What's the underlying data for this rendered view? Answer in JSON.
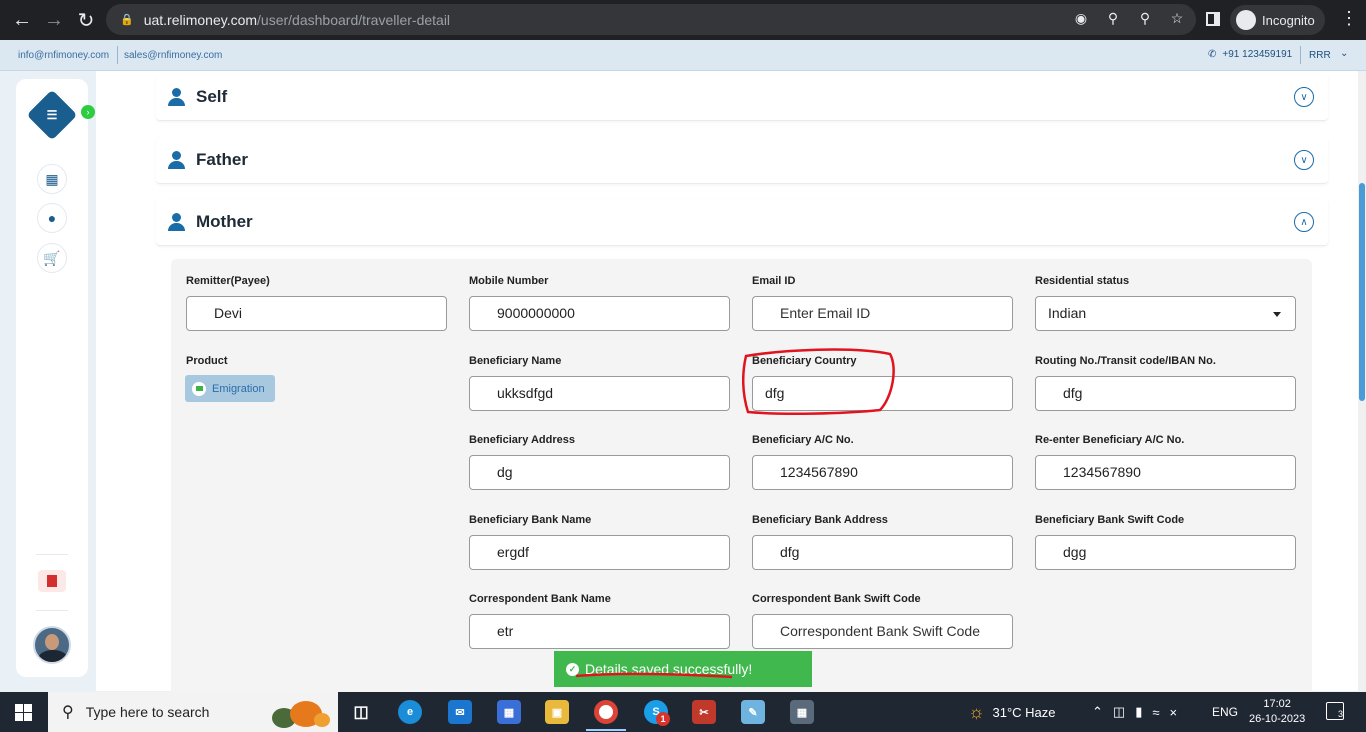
{
  "browser": {
    "url_host": "uat.relimoney.com",
    "url_path": "/user/dashboard/traveller-detail",
    "profile_label": "Incognito"
  },
  "topbar": {
    "email_info": "info@rnfimoney.com",
    "email_sales": "sales@rnfimoney.com",
    "phone": "+91 123459191",
    "account": "RRR"
  },
  "sections": [
    {
      "title": "Self",
      "expanded": false
    },
    {
      "title": "Father",
      "expanded": false
    },
    {
      "title": "Mother",
      "expanded": true
    }
  ],
  "form": {
    "remitter_label": "Remitter(Payee)",
    "remitter_value": "Devi",
    "mobile_label": "Mobile Number",
    "mobile_value": "9000000000",
    "email_label": "Email ID",
    "email_placeholder": "Enter Email ID",
    "residential_label": "Residential status",
    "residential_value": "Indian",
    "product_label": "Product",
    "product_value": "Emigration",
    "beneficiary_name_label": "Beneficiary Name",
    "beneficiary_name_value": "ukksdfgd",
    "beneficiary_country_label": "Beneficiary Country",
    "beneficiary_country_value": "dfg",
    "routing_label": "Routing No./Transit code/IBAN No.",
    "routing_value": "dfg",
    "beneficiary_address_label": "Beneficiary Address",
    "beneficiary_address_value": "dg",
    "beneficiary_ac_label": "Beneficiary A/C No.",
    "beneficiary_ac_value": "1234567890",
    "reenter_ac_label": "Re-enter Beneficiary A/C No.",
    "reenter_ac_value": "1234567890",
    "bank_name_label": "Beneficiary Bank Name",
    "bank_name_value": "ergdf",
    "bank_address_label": "Beneficiary Bank Address",
    "bank_address_value": "dfg",
    "swift_label": "Beneficiary Bank Swift Code",
    "swift_value": "dgg",
    "corr_bank_label": "Correspondent Bank Name",
    "corr_bank_value": "etr",
    "corr_swift_label": "Correspondent Bank Swift Code",
    "corr_swift_placeholder": "Correspondent Bank Swift Code"
  },
  "toast": {
    "message": "Details saved successfully!"
  },
  "taskbar": {
    "search_placeholder": "Type here to search",
    "weather": "31°C  Haze",
    "language": "ENG",
    "time": "17:02",
    "date": "26-10-2023",
    "notifications": "3",
    "skype_badge": "1"
  },
  "colors": {
    "brand": "#1a6ca8",
    "success": "#41b84d",
    "annotation": "#e0141e"
  }
}
